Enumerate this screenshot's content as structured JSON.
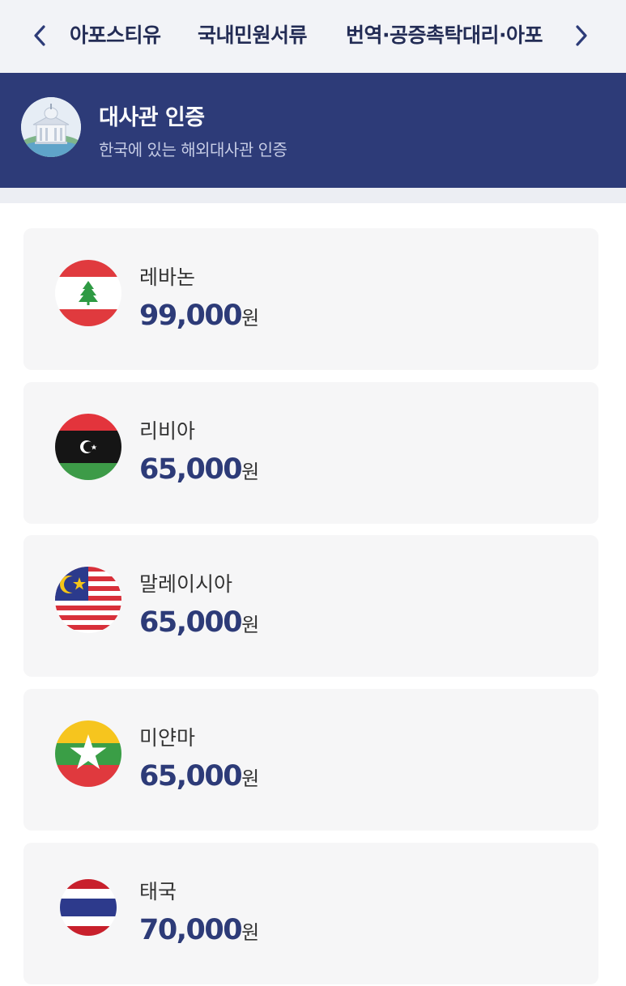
{
  "nav": {
    "tabs": [
      {
        "label": "아포스티유"
      },
      {
        "label": "국내민원서류"
      },
      {
        "label": "번역·공증촉탁대리·아포"
      }
    ],
    "prev_icon": "chevron-left-icon",
    "next_icon": "chevron-right-icon"
  },
  "header": {
    "title": "대사관 인증",
    "subtitle": "한국에 있는 해외대사관 인증",
    "icon": "embassy-building-icon"
  },
  "items": [
    {
      "country": "레바논",
      "price": "99,000",
      "unit": "원",
      "flag": "lebanon-flag-icon"
    },
    {
      "country": "리비아",
      "price": "65,000",
      "unit": "원",
      "flag": "libya-flag-icon"
    },
    {
      "country": "말레이시아",
      "price": "65,000",
      "unit": "원",
      "flag": "malaysia-flag-icon"
    },
    {
      "country": "미얀마",
      "price": "65,000",
      "unit": "원",
      "flag": "myanmar-flag-icon"
    },
    {
      "country": "태국",
      "price": "70,000",
      "unit": "원",
      "flag": "thailand-flag-icon"
    }
  ],
  "colors": {
    "brand_navy": "#2d3b78",
    "nav_bg": "#f2f3f7",
    "card_bg": "#f6f6f7"
  }
}
